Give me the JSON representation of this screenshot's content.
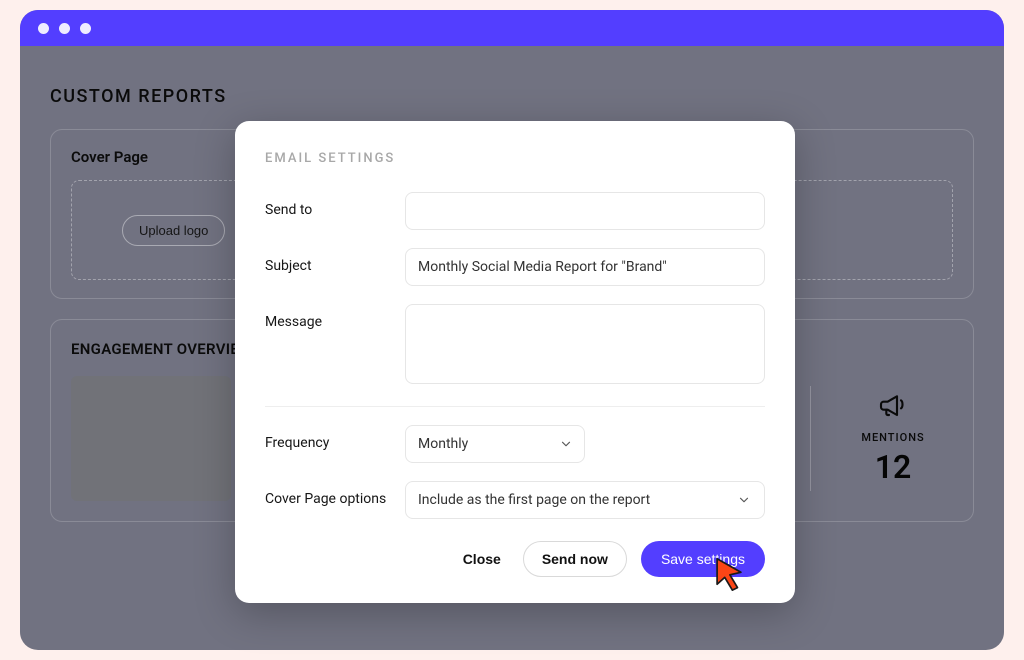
{
  "page": {
    "title": "CUSTOM REPORTS"
  },
  "cover_card": {
    "title": "Cover Page",
    "upload_label": "Upload logo"
  },
  "engagement_card": {
    "title": "ENGAGEMENT OVERVIEW",
    "mentions_label": "MENTIONS",
    "mentions_value": "12"
  },
  "modal": {
    "title": "EMAIL SETTINGS",
    "labels": {
      "send_to": "Send to",
      "subject": "Subject",
      "message": "Message",
      "frequency": "Frequency",
      "cover_options": "Cover Page options"
    },
    "values": {
      "send_to": "",
      "subject": "Monthly Social Media Report for \"Brand\"",
      "message": "",
      "frequency": "Monthly",
      "cover_options": "Include as the first page on the report"
    },
    "buttons": {
      "close": "Close",
      "send_now": "Send now",
      "save": "Save settings"
    }
  },
  "colors": {
    "accent": "#533EFF",
    "cursor": "#FA4516"
  }
}
